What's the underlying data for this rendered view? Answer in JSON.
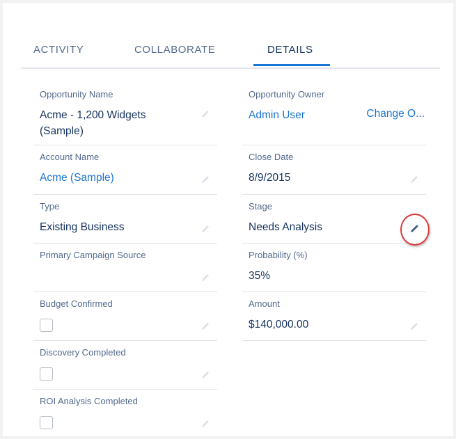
{
  "tabs": [
    {
      "label": "ACTIVITY",
      "active": false
    },
    {
      "label": "COLLABORATE",
      "active": false
    },
    {
      "label": "DETAILS",
      "active": true
    }
  ],
  "left_fields": [
    {
      "label": "Opportunity Name",
      "value": "Acme - 1,200 Widgets (Sample)",
      "type": "text",
      "editable": true
    },
    {
      "label": "Account Name",
      "value": "Acme (Sample)",
      "type": "link",
      "editable": true
    },
    {
      "label": "Type",
      "value": "Existing Business",
      "type": "text",
      "editable": true
    },
    {
      "label": "Primary Campaign Source",
      "value": "",
      "type": "text",
      "editable": true
    },
    {
      "label": "Budget Confirmed",
      "checked": false,
      "type": "checkbox",
      "editable": true
    },
    {
      "label": "Discovery Completed",
      "checked": false,
      "type": "checkbox",
      "editable": true
    },
    {
      "label": "ROI Analysis Completed",
      "checked": false,
      "type": "checkbox",
      "editable": true
    }
  ],
  "right_fields": [
    {
      "label": "Opportunity Owner",
      "value": "Admin User",
      "type": "link",
      "action_label": "Change O...",
      "editable": false
    },
    {
      "label": "Close Date",
      "value": "8/9/2015",
      "type": "text",
      "editable": true
    },
    {
      "label": "Stage",
      "value": "Needs Analysis",
      "type": "text",
      "editable": true,
      "highlighted": true
    },
    {
      "label": "Probability (%)",
      "value": "35%",
      "type": "text",
      "editable": false
    },
    {
      "label": "Amount",
      "value": "$140,000.00",
      "type": "text",
      "editable": true
    }
  ],
  "colors": {
    "accent": "#1677d6",
    "link": "#1a75cf",
    "label": "#54698d",
    "value": "#16325c",
    "highlight_ring": "#d93a3a",
    "pencil_muted": "#dde1e8",
    "pencil_active": "#3c5a85"
  },
  "icons": {
    "edit": "pencil-icon"
  }
}
